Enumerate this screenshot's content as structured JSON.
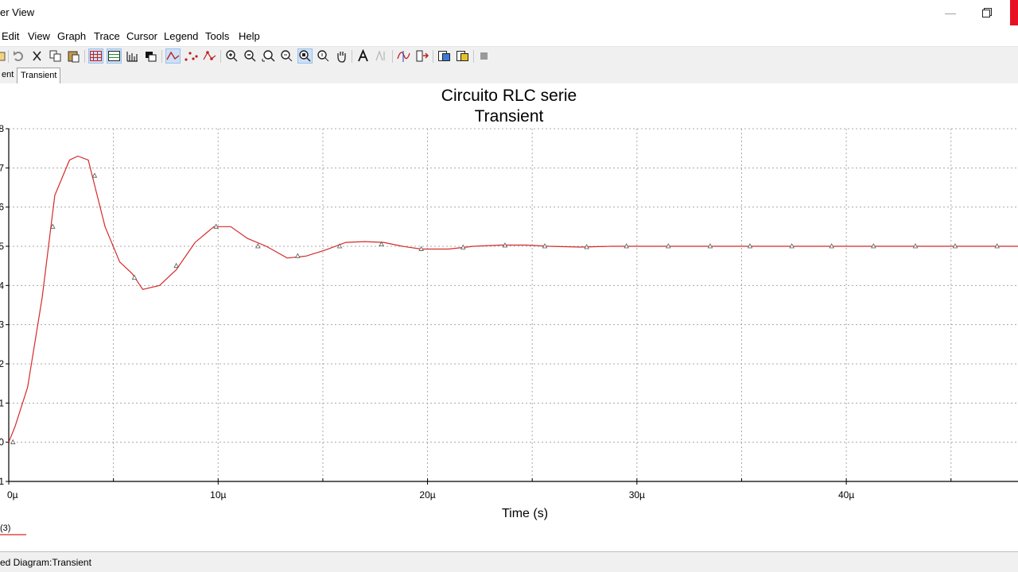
{
  "window": {
    "title": "er View"
  },
  "menu": {
    "items": [
      "Edit",
      "View",
      "Graph",
      "Trace",
      "Cursor",
      "Legend",
      "Tools",
      "Help"
    ]
  },
  "toolbar": {
    "icons": [
      "open-icon",
      "undo-icon",
      "cut-icon",
      "copy-icon",
      "paste-icon",
      "grid-icon",
      "show-legend-icon",
      "overview-icon",
      "copy-properties-icon",
      "line-trace-icon",
      "dot-trace-icon",
      "line-dot-trace-icon",
      "zoom-in-icon",
      "zoom-out-icon",
      "zoom-area-icon",
      "zoom-x-icon",
      "zoom-full-icon",
      "zoom-y-icon",
      "pan-icon",
      "text-icon",
      "show-cursors-icon",
      "cursor-data-icon",
      "select-marks-icon",
      "export-excel-icon",
      "export-mathcad-icon",
      "stop-icon"
    ]
  },
  "tabs": [
    "ent",
    "Transient"
  ],
  "chart_data": {
    "type": "line",
    "title": "Circuito RLC serie",
    "subtitle": "Transient",
    "xlabel": "Time (s)",
    "ylabel": "",
    "xlim": [
      0,
      48.2
    ],
    "ylim": [
      -0.1,
      0.8
    ],
    "x_unit": "µs",
    "grid": true,
    "x_ticks": [
      {
        "value": 0,
        "label": "0µ"
      },
      {
        "value": 10,
        "label": "10µ"
      },
      {
        "value": 20,
        "label": "20µ"
      },
      {
        "value": 30,
        "label": "30µ"
      },
      {
        "value": 40,
        "label": "40µ"
      }
    ],
    "y_ticks": [
      {
        "value": 0.8,
        "label": "8"
      },
      {
        "value": 0.7,
        "label": "7"
      },
      {
        "value": 0.6,
        "label": "6"
      },
      {
        "value": 0.5,
        "label": "5"
      },
      {
        "value": 0.4,
        "label": "4"
      },
      {
        "value": 0.3,
        "label": "3"
      },
      {
        "value": 0.2,
        "label": "2"
      },
      {
        "value": 0.1,
        "label": "1"
      },
      {
        "value": 0.0,
        "label": "0"
      },
      {
        "value": -0.1,
        "label": "1"
      }
    ],
    "series": [
      {
        "name": "(3)",
        "color": "#d42a2a",
        "marker": "triangle",
        "x": [
          0,
          0.3,
          0.9,
          1.6,
          2.2,
          2.9,
          3.3,
          3.8,
          4.6,
          5.3,
          5.9,
          6.4,
          7.2,
          8.0,
          8.9,
          9.8,
          10.6,
          11.4,
          12.3,
          13.3,
          14.2,
          15.1,
          16.1,
          17.0,
          17.9,
          18.8,
          19.7,
          21.0,
          22.2,
          23.5,
          24.7,
          25.8,
          27.3,
          28.8,
          30.3,
          32,
          34,
          36,
          38,
          40,
          42,
          44,
          46,
          48.2
        ],
        "y": [
          0.0,
          0.04,
          0.14,
          0.37,
          0.63,
          0.72,
          0.73,
          0.72,
          0.55,
          0.46,
          0.43,
          0.39,
          0.4,
          0.44,
          0.51,
          0.55,
          0.55,
          0.52,
          0.5,
          0.47,
          0.475,
          0.49,
          0.51,
          0.512,
          0.51,
          0.5,
          0.493,
          0.493,
          0.5,
          0.503,
          0.503,
          0.5,
          0.498,
          0.5,
          0.5,
          0.5,
          0.5,
          0.5,
          0.5,
          0.5,
          0.5,
          0.5,
          0.5,
          0.5
        ],
        "marker_x": [
          0.2,
          2.1,
          4.1,
          6.0,
          8.0,
          9.9,
          11.9,
          13.8,
          15.8,
          17.8,
          19.7,
          21.7,
          23.7,
          25.6,
          27.6,
          29.5,
          31.5,
          33.5,
          35.4,
          37.4,
          39.3,
          41.3,
          43.3,
          45.2,
          47.2
        ],
        "marker_y": [
          0.0,
          0.55,
          0.68,
          0.42,
          0.45,
          0.55,
          0.5,
          0.475,
          0.5,
          0.505,
          0.493,
          0.497,
          0.502,
          0.5,
          0.498,
          0.5,
          0.5,
          0.5,
          0.5,
          0.5,
          0.5,
          0.5,
          0.5,
          0.5,
          0.5
        ]
      }
    ],
    "legend": {
      "label": "(3)",
      "placement": "bottom-left"
    }
  },
  "status": {
    "text": "ed Diagram:Transient"
  }
}
